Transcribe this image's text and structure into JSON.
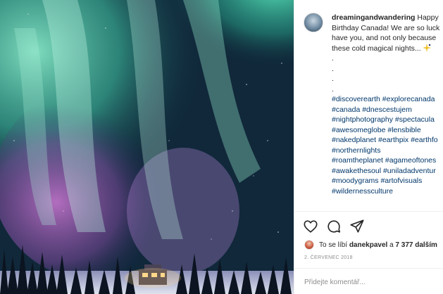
{
  "post": {
    "image_alt": "Aurora borealis over snowy forest with lit cabin",
    "username": "dreamingandwandering",
    "caption_lines": [
      "Happy",
      "Birthday Canada! We are so luck",
      "have you, and not only because",
      "these cold magical nights..."
    ],
    "dots": [
      ".",
      ".",
      ".",
      "."
    ],
    "hashtags": [
      "#discoverearth #explorecanada",
      "#canada #dnescestujem",
      "#nightphotography #spectacula",
      "#awesomeglobe #lensbible",
      "#nakedplanet #earthpix #earthfo",
      "#northernlights",
      "#roamtheplanet #agameoftones",
      "#awakethesoul #uniladadventur",
      "#moodygrams #artofvisuals",
      "#wildernessculture"
    ],
    "likes": {
      "prefix": "To se líbí",
      "user": "danekpavel",
      "connector": "a",
      "others": "7 377 dalším"
    },
    "date": "2. ČERVENEC 2018",
    "comment_placeholder": "Přidejte komentář..."
  },
  "icons": [
    "heart-icon",
    "comment-icon",
    "share-icon",
    "emoji-icon"
  ],
  "colors": {
    "hashtag": "#00376b",
    "text": "#262626",
    "muted": "#8e8e8e"
  }
}
